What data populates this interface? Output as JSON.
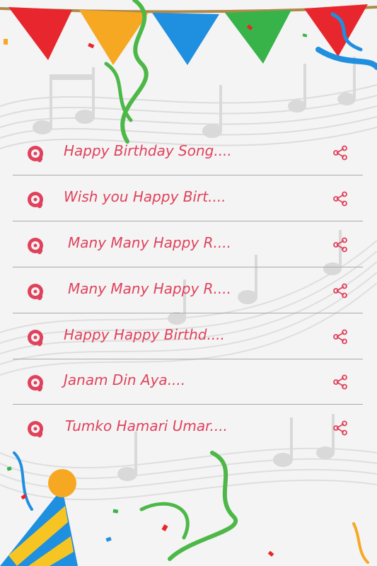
{
  "songs": [
    {
      "title": "Happy Birthday Song...."
    },
    {
      "title": "Wish you Happy Birt...."
    },
    {
      "title": "Many Many Happy R...."
    },
    {
      "title": "Many Many Happy R...."
    },
    {
      "title": "Happy Happy Birthd...."
    },
    {
      "title": "Janam Din Aya...."
    },
    {
      "title": "Tumko Hamari Umar...."
    }
  ],
  "icons": {
    "song": "music-disc-icon",
    "share": "share-icon"
  },
  "colors": {
    "accent": "#e0425c",
    "divider": "#a9a9a9",
    "background": "#f4f4f4"
  }
}
